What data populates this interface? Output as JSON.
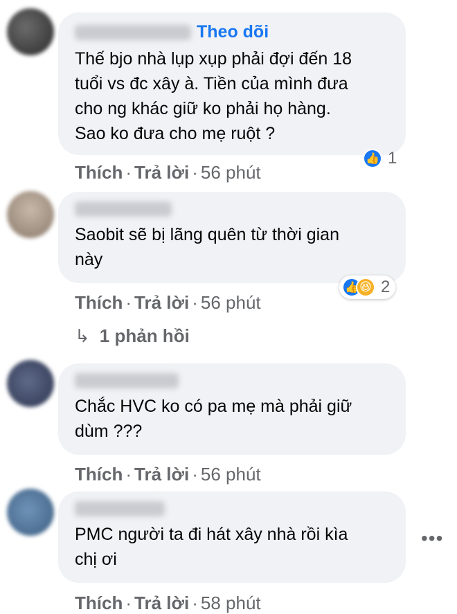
{
  "comments": [
    {
      "follow_label": "Theo dõi",
      "text_lines": [
        "Thế bjo nhà lụp xụp phải đợi đến 18",
        "tuổi vs đc xây à. Tiền của mình đưa",
        "cho ng khác giữ ko phải họ hàng.",
        "Sao ko đưa cho mẹ ruột ?"
      ],
      "reaction_count": "1",
      "like_label": "Thích",
      "reply_label": "Trả lời",
      "time": "56 phút"
    },
    {
      "text_lines": [
        "Saobit sẽ bị lãng quên từ thời gian",
        "này"
      ],
      "reaction_count": "2",
      "like_label": "Thích",
      "reply_label": "Trả lời",
      "time": "56 phút",
      "replies_label": "1 phản hồi"
    },
    {
      "text_lines": [
        "Chắc HVC ko có pa mẹ mà phải giữ",
        "dùm ???"
      ],
      "like_label": "Thích",
      "reply_label": "Trả lời",
      "time": "56 phút"
    },
    {
      "text_lines": [
        "PMC người ta đi hát xây nhà rồi kìa",
        "chị ơi"
      ],
      "like_label": "Thích",
      "reply_label": "Trả lời",
      "time": "58 phút"
    }
  ],
  "icons": {
    "like": "thumbs-up-icon",
    "haha": "laugh-icon",
    "reply_arrow": "reply-arrow-icon",
    "more": "more-options-icon"
  },
  "colors": {
    "accent": "#1877f2",
    "bubble": "#f0f2f5",
    "meta": "#65676b",
    "haha": "#f7b125"
  }
}
